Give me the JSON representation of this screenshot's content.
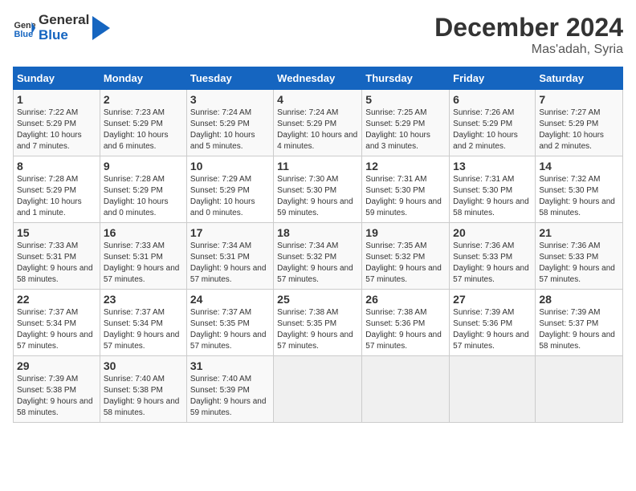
{
  "header": {
    "logo_general": "General",
    "logo_blue": "Blue",
    "title": "December 2024",
    "subtitle": "Mas'adah, Syria"
  },
  "calendar": {
    "days_of_week": [
      "Sunday",
      "Monday",
      "Tuesday",
      "Wednesday",
      "Thursday",
      "Friday",
      "Saturday"
    ],
    "weeks": [
      [
        null,
        null,
        null,
        null,
        null,
        null,
        null
      ]
    ],
    "cells": [
      {
        "day": null,
        "empty": true
      },
      {
        "day": null,
        "empty": true
      },
      {
        "day": null,
        "empty": true
      },
      {
        "day": null,
        "empty": true
      },
      {
        "day": null,
        "empty": true
      },
      {
        "day": null,
        "empty": true
      },
      {
        "day": null,
        "empty": true
      }
    ]
  },
  "rows": [
    [
      {
        "num": "1",
        "sunrise": "7:22 AM",
        "sunset": "5:29 PM",
        "daylight": "10 hours and 7 minutes."
      },
      {
        "num": "2",
        "sunrise": "7:23 AM",
        "sunset": "5:29 PM",
        "daylight": "10 hours and 6 minutes."
      },
      {
        "num": "3",
        "sunrise": "7:24 AM",
        "sunset": "5:29 PM",
        "daylight": "10 hours and 5 minutes."
      },
      {
        "num": "4",
        "sunrise": "7:24 AM",
        "sunset": "5:29 PM",
        "daylight": "10 hours and 4 minutes."
      },
      {
        "num": "5",
        "sunrise": "7:25 AM",
        "sunset": "5:29 PM",
        "daylight": "10 hours and 3 minutes."
      },
      {
        "num": "6",
        "sunrise": "7:26 AM",
        "sunset": "5:29 PM",
        "daylight": "10 hours and 2 minutes."
      },
      {
        "num": "7",
        "sunrise": "7:27 AM",
        "sunset": "5:29 PM",
        "daylight": "10 hours and 2 minutes."
      }
    ],
    [
      {
        "num": "8",
        "sunrise": "7:28 AM",
        "sunset": "5:29 PM",
        "daylight": "10 hours and 1 minute."
      },
      {
        "num": "9",
        "sunrise": "7:28 AM",
        "sunset": "5:29 PM",
        "daylight": "10 hours and 0 minutes."
      },
      {
        "num": "10",
        "sunrise": "7:29 AM",
        "sunset": "5:29 PM",
        "daylight": "10 hours and 0 minutes."
      },
      {
        "num": "11",
        "sunrise": "7:30 AM",
        "sunset": "5:30 PM",
        "daylight": "9 hours and 59 minutes."
      },
      {
        "num": "12",
        "sunrise": "7:31 AM",
        "sunset": "5:30 PM",
        "daylight": "9 hours and 59 minutes."
      },
      {
        "num": "13",
        "sunrise": "7:31 AM",
        "sunset": "5:30 PM",
        "daylight": "9 hours and 58 minutes."
      },
      {
        "num": "14",
        "sunrise": "7:32 AM",
        "sunset": "5:30 PM",
        "daylight": "9 hours and 58 minutes."
      }
    ],
    [
      {
        "num": "15",
        "sunrise": "7:33 AM",
        "sunset": "5:31 PM",
        "daylight": "9 hours and 58 minutes."
      },
      {
        "num": "16",
        "sunrise": "7:33 AM",
        "sunset": "5:31 PM",
        "daylight": "9 hours and 57 minutes."
      },
      {
        "num": "17",
        "sunrise": "7:34 AM",
        "sunset": "5:31 PM",
        "daylight": "9 hours and 57 minutes."
      },
      {
        "num": "18",
        "sunrise": "7:34 AM",
        "sunset": "5:32 PM",
        "daylight": "9 hours and 57 minutes."
      },
      {
        "num": "19",
        "sunrise": "7:35 AM",
        "sunset": "5:32 PM",
        "daylight": "9 hours and 57 minutes."
      },
      {
        "num": "20",
        "sunrise": "7:36 AM",
        "sunset": "5:33 PM",
        "daylight": "9 hours and 57 minutes."
      },
      {
        "num": "21",
        "sunrise": "7:36 AM",
        "sunset": "5:33 PM",
        "daylight": "9 hours and 57 minutes."
      }
    ],
    [
      {
        "num": "22",
        "sunrise": "7:37 AM",
        "sunset": "5:34 PM",
        "daylight": "9 hours and 57 minutes."
      },
      {
        "num": "23",
        "sunrise": "7:37 AM",
        "sunset": "5:34 PM",
        "daylight": "9 hours and 57 minutes."
      },
      {
        "num": "24",
        "sunrise": "7:37 AM",
        "sunset": "5:35 PM",
        "daylight": "9 hours and 57 minutes."
      },
      {
        "num": "25",
        "sunrise": "7:38 AM",
        "sunset": "5:35 PM",
        "daylight": "9 hours and 57 minutes."
      },
      {
        "num": "26",
        "sunrise": "7:38 AM",
        "sunset": "5:36 PM",
        "daylight": "9 hours and 57 minutes."
      },
      {
        "num": "27",
        "sunrise": "7:39 AM",
        "sunset": "5:36 PM",
        "daylight": "9 hours and 57 minutes."
      },
      {
        "num": "28",
        "sunrise": "7:39 AM",
        "sunset": "5:37 PM",
        "daylight": "9 hours and 58 minutes."
      }
    ],
    [
      {
        "num": "29",
        "sunrise": "7:39 AM",
        "sunset": "5:38 PM",
        "daylight": "9 hours and 58 minutes."
      },
      {
        "num": "30",
        "sunrise": "7:40 AM",
        "sunset": "5:38 PM",
        "daylight": "9 hours and 58 minutes."
      },
      {
        "num": "31",
        "sunrise": "7:40 AM",
        "sunset": "5:39 PM",
        "daylight": "9 hours and 59 minutes."
      },
      null,
      null,
      null,
      null
    ]
  ],
  "labels": {
    "sunrise": "Sunrise:",
    "sunset": "Sunset:",
    "daylight": "Daylight:"
  }
}
